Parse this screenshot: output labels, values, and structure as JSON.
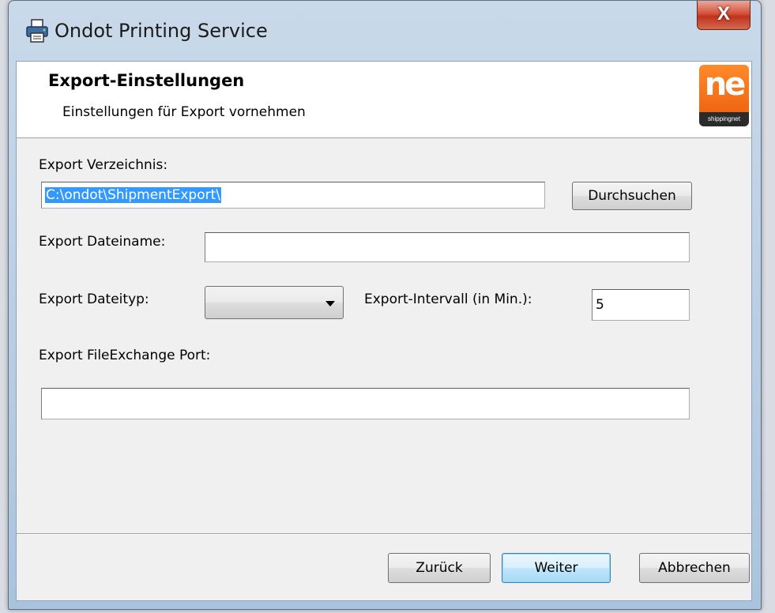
{
  "window": {
    "title": "Ondot Printing Service",
    "close_glyph": "X"
  },
  "header": {
    "title": "Export-Einstellungen",
    "subtitle": "Einstellungen für Export vornehmen",
    "logo_text": "ne",
    "logo_caption": "shippingnet"
  },
  "form": {
    "directory_label": "Export Verzeichnis:",
    "directory_value": "C:\\ondot\\ShipmentExport\\",
    "browse_label": "Durchsuchen",
    "filename_label": "Export Dateiname:",
    "filename_value": "",
    "filetype_label": "Export Dateityp:",
    "filetype_value": "",
    "interval_label": "Export-Intervall (in Min.):",
    "interval_value": "5",
    "port_label": "Export FileExchange Port:",
    "port_value": ""
  },
  "footer": {
    "back_label": "Zurück",
    "next_label": "Weiter",
    "cancel_label": "Abbrechen"
  },
  "colors": {
    "selection": "#3399ff",
    "logo_orange": "#ea5b0c",
    "close_red": "#c0331d"
  },
  "icons": {
    "app": "printer-icon",
    "dropdown": "chevron-down-icon"
  }
}
